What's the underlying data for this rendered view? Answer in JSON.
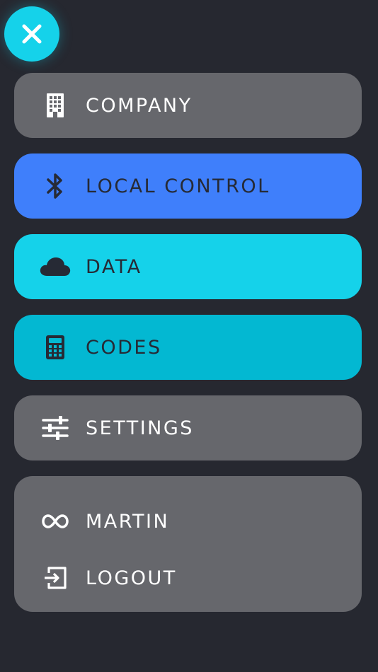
{
  "colors": {
    "background": "#262830",
    "close_button": "#15d2ea",
    "neutral_item": "#66676c",
    "local_control": "#3f7ffb",
    "data": "#15d2ea",
    "codes": "#03b8d2",
    "light_text": "#ffffff",
    "dark_text": "#262a35"
  },
  "close_button": {
    "icon": "close-icon"
  },
  "menu": {
    "items": [
      {
        "label": "COMPANY",
        "icon": "building-icon"
      },
      {
        "label": "LOCAL CONTROL",
        "icon": "bluetooth-icon"
      },
      {
        "label": "DATA",
        "icon": "cloud-icon"
      },
      {
        "label": "CODES",
        "icon": "calculator-icon"
      },
      {
        "label": "SETTINGS",
        "icon": "sliders-icon"
      }
    ]
  },
  "user": {
    "name": "MARTIN",
    "name_icon": "infinity-icon",
    "logout_label": "LOGOUT",
    "logout_icon": "logout-icon"
  }
}
